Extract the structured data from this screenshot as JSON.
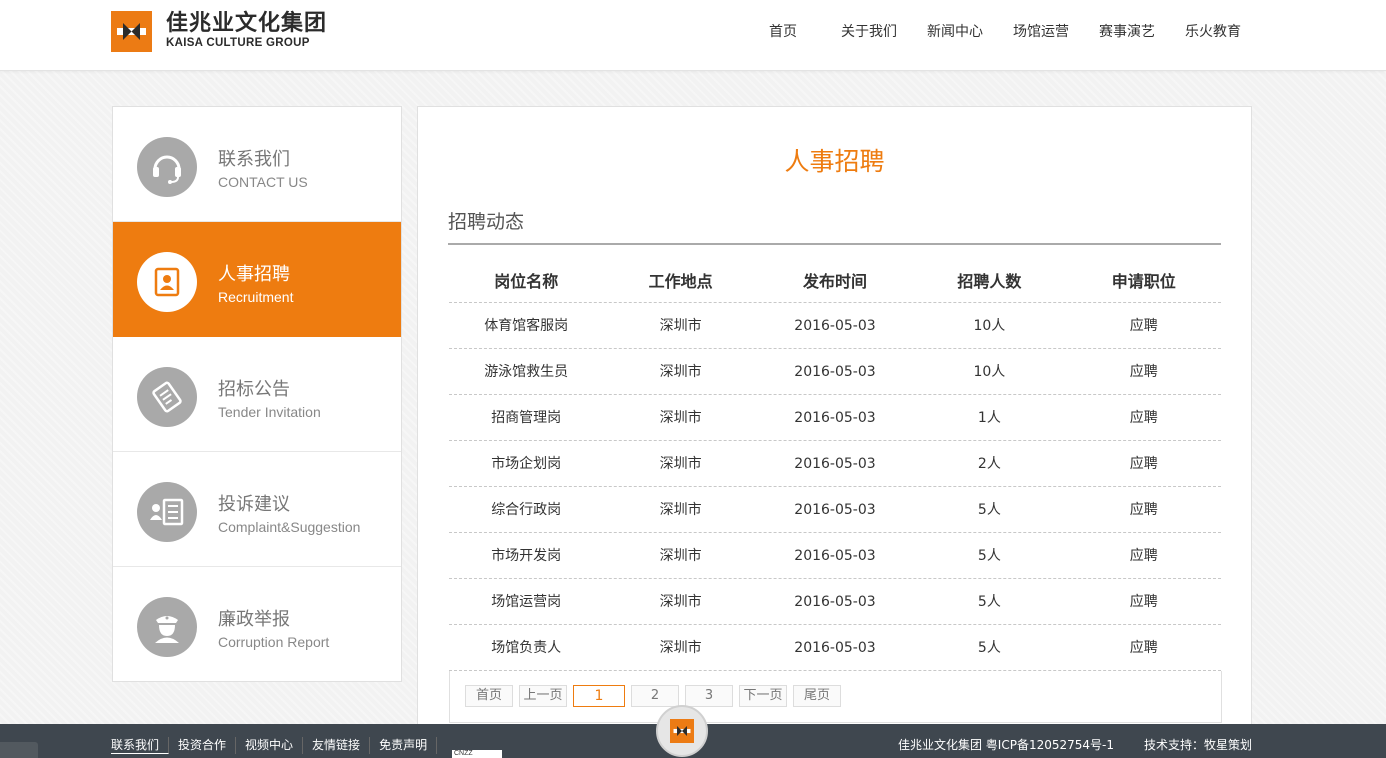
{
  "brand": {
    "name_cn": "佳兆业文化集团",
    "name_en": "KAISA CULTURE GROUP",
    "accent": "#ee7c10"
  },
  "nav": [
    "首页",
    "关于我们",
    "新闻中心",
    "场馆运营",
    "赛事演艺",
    "乐火教育"
  ],
  "sidebar": {
    "items": [
      {
        "cn": "联系我们",
        "en": "CONTACT US",
        "icon": "headset-icon"
      },
      {
        "cn": "人事招聘",
        "en": "Recruitment",
        "icon": "id-badge-icon",
        "active": true
      },
      {
        "cn": "招标公告",
        "en": "Tender Invitation",
        "icon": "document-stamp-icon"
      },
      {
        "cn": "投诉建议",
        "en": "Complaint&Suggestion",
        "icon": "person-list-icon"
      },
      {
        "cn": "廉政举报",
        "en": "Corruption Report",
        "icon": "police-officer-icon"
      }
    ]
  },
  "main": {
    "title": "人事招聘",
    "section": "招聘动态",
    "columns": [
      "岗位名称",
      "工作地点",
      "发布时间",
      "招聘人数",
      "申请职位"
    ],
    "rows": [
      [
        "体育馆客服岗",
        "深圳市",
        "2016-05-03",
        "10人",
        "应聘"
      ],
      [
        "游泳馆救生员",
        "深圳市",
        "2016-05-03",
        "10人",
        "应聘"
      ],
      [
        "招商管理岗",
        "深圳市",
        "2016-05-03",
        "1人",
        "应聘"
      ],
      [
        "市场企划岗",
        "深圳市",
        "2016-05-03",
        "2人",
        "应聘"
      ],
      [
        "综合行政岗",
        "深圳市",
        "2016-05-03",
        "5人",
        "应聘"
      ],
      [
        "市场开发岗",
        "深圳市",
        "2016-05-03",
        "5人",
        "应聘"
      ],
      [
        "场馆运营岗",
        "深圳市",
        "2016-05-03",
        "5人",
        "应聘"
      ],
      [
        "场馆负责人",
        "深圳市",
        "2016-05-03",
        "5人",
        "应聘"
      ]
    ],
    "pager": {
      "first": "首页",
      "prev": "上一页",
      "pages": [
        "1",
        "2",
        "3"
      ],
      "current": "1",
      "next": "下一页",
      "last": "尾页"
    }
  },
  "footer": {
    "links": [
      "联系我们",
      "投资合作",
      "视频中心",
      "友情链接",
      "免责声明"
    ],
    "copyright": "佳兆业文化集团 粤ICP备12052754号-1",
    "support": "技术支持：牧星策划",
    "cnzz": "CNZZ"
  }
}
